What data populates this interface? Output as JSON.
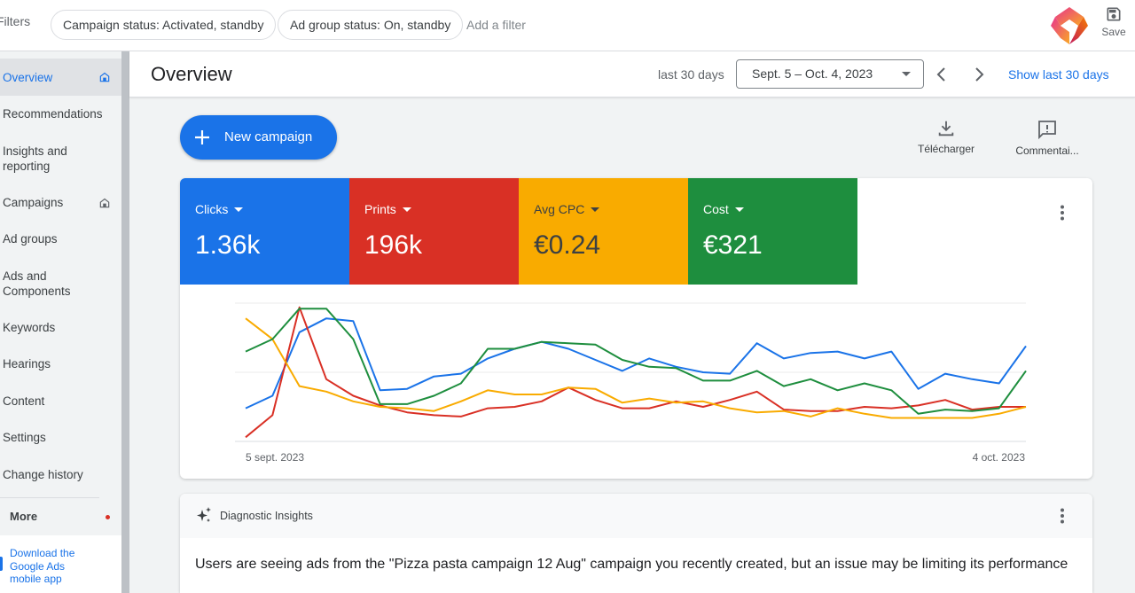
{
  "topbar": {
    "filters_label": "Filters",
    "chips": [
      "Campaign status: Activated, standby",
      "Ad group status: On, standby"
    ],
    "add_filter": "Add a filter",
    "save_label": "Save"
  },
  "sidebar": {
    "items": [
      {
        "label": "Overview",
        "active": true,
        "icon": "home-icon"
      },
      {
        "label": "Recommendations"
      },
      {
        "label": "Insights and reporting"
      },
      {
        "label": "Campaigns",
        "icon": "home-icon"
      },
      {
        "label": "Ad groups"
      },
      {
        "label": "Ads and Components"
      },
      {
        "label": "Keywords"
      },
      {
        "label": "Hearings"
      },
      {
        "label": "Content"
      },
      {
        "label": "Settings"
      },
      {
        "label": "Change history"
      }
    ],
    "more_label": "More",
    "download_app": "Download the Google Ads mobile app"
  },
  "header": {
    "title": "Overview",
    "range_label": "last 30 days",
    "date_range": "Sept. 5 – Oct. 4, 2023",
    "show_last": "Show last 30 days"
  },
  "actions": {
    "new_campaign": "New campaign",
    "download": "Télécharger",
    "comments": "Commentai..."
  },
  "metrics": [
    {
      "label": "Clicks",
      "value": "1.36k",
      "color": "#1a73e8",
      "text_color": "#ffffff"
    },
    {
      "label": "Prints",
      "value": "196k",
      "color": "#d93025",
      "text_color": "#ffffff"
    },
    {
      "label": "Avg CPC",
      "value": "€0.24",
      "color": "#f9ab00",
      "text_color": "#3c4043"
    },
    {
      "label": "Cost",
      "value": "€321",
      "color": "#1e8e3e",
      "text_color": "#ffffff"
    }
  ],
  "chart_data": {
    "type": "line",
    "title": "",
    "xlabel": "",
    "ylabel": "",
    "x_start_label": "5 sept. 2023",
    "x_end_label": "4 oct. 2023",
    "ylim": [
      0,
      100
    ],
    "y_units": "normalized (per-series scale, axes hidden)",
    "grid": true,
    "series": [
      {
        "name": "Clicks",
        "color": "#1a73e8",
        "values": [
          24,
          33,
          79,
          89,
          87,
          37,
          38,
          47,
          49,
          60,
          67,
          72,
          67,
          59,
          51,
          60,
          54,
          50,
          49,
          71,
          60,
          64,
          65,
          60,
          65,
          38,
          49,
          45,
          42,
          69
        ]
      },
      {
        "name": "Prints",
        "color": "#d93025",
        "values": [
          3,
          19,
          97,
          45,
          33,
          26,
          21,
          19,
          18,
          24,
          25,
          29,
          39,
          30,
          24,
          24,
          29,
          25,
          30,
          36,
          23,
          22,
          22,
          25,
          24,
          26,
          30,
          23,
          25,
          25
        ]
      },
      {
        "name": "Avg CPC",
        "color": "#f9ab00",
        "values": [
          89,
          74,
          40,
          36,
          29,
          25,
          24,
          22,
          29,
          37,
          34,
          34,
          39,
          38,
          28,
          31,
          28,
          29,
          24,
          21,
          22,
          18,
          24,
          20,
          17,
          17,
          17,
          17,
          20,
          25
        ]
      },
      {
        "name": "Cost",
        "color": "#1e8e3e",
        "values": [
          65,
          74,
          96,
          96,
          74,
          27,
          27,
          33,
          42,
          67,
          67,
          72,
          71,
          70,
          59,
          54,
          53,
          44,
          44,
          51,
          40,
          45,
          37,
          42,
          37,
          20,
          23,
          22,
          24,
          51
        ]
      }
    ]
  },
  "insights": {
    "title": "Diagnostic Insights",
    "text": "Users are seeing ads from the \"Pizza pasta campaign 12 Aug\" campaign you recently created, but an issue may be limiting its performance"
  }
}
